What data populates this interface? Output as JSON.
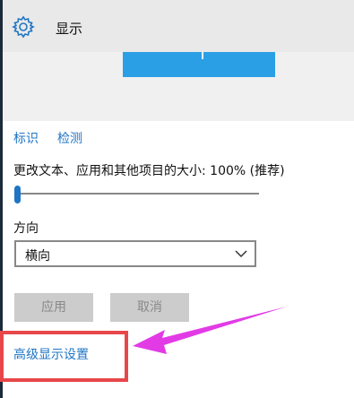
{
  "header": {
    "title": "显示",
    "settings_icon": "gear-icon"
  },
  "display_links": {
    "identify": "标识",
    "detect": "检测"
  },
  "scale": {
    "label": "更改文本、应用和其他项目的大小: 100% (推荐)",
    "slider_level": 0
  },
  "orientation": {
    "label": "方向",
    "selected": "横向",
    "chevron_icon": "chevron-down-icon"
  },
  "buttons": {
    "apply": "应用",
    "cancel": "取消"
  },
  "advanced_link": "高级显示设置",
  "colors": {
    "accent": "#1f75c4",
    "monitor": "#2a9fe6",
    "highlight_box": "#e8474a",
    "annotation_arrow": "#e23be6"
  }
}
